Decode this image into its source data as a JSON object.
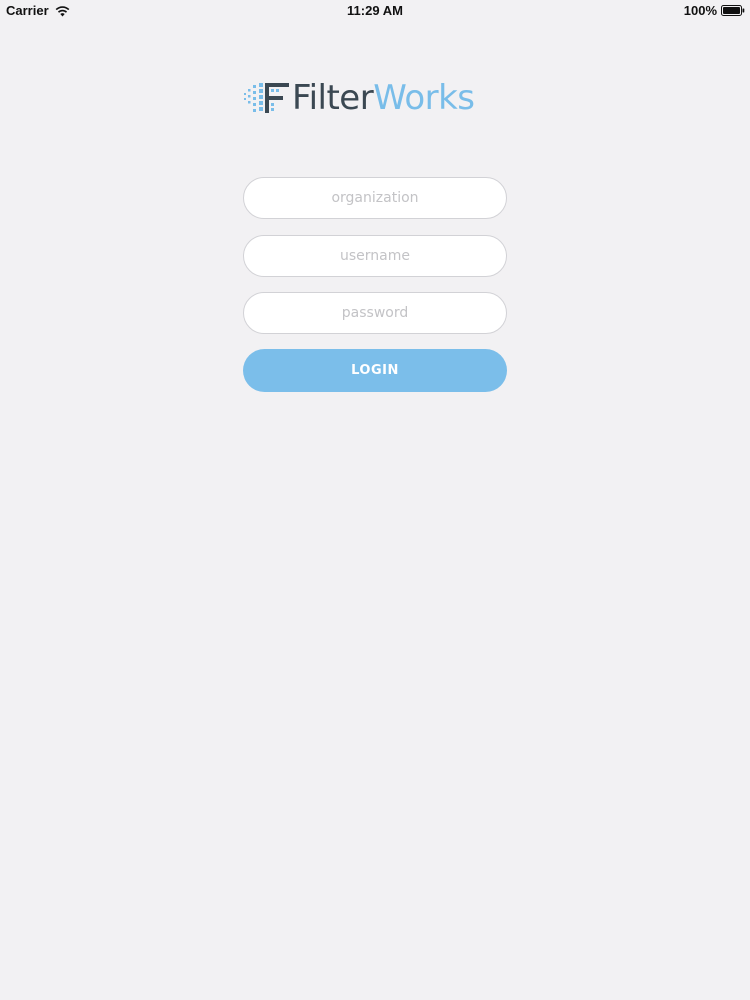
{
  "status_bar": {
    "carrier": "Carrier",
    "time": "11:29 AM",
    "battery": "100%"
  },
  "logo": {
    "word_part1": "Filter",
    "word_part2": "Works",
    "color_dark": "#3b4852",
    "color_accent": "#79bde9"
  },
  "form": {
    "organization_placeholder": "organization",
    "username_placeholder": "username",
    "password_placeholder": "password",
    "login_label": "LOGIN"
  },
  "colors": {
    "background": "#f2f1f3",
    "button": "#7bbeea",
    "field_border": "#d2d2d6"
  },
  "icons": {
    "wifi": "wifi-icon",
    "battery": "battery-icon",
    "logo_mark": "filterworks-logo-mark-icon"
  }
}
